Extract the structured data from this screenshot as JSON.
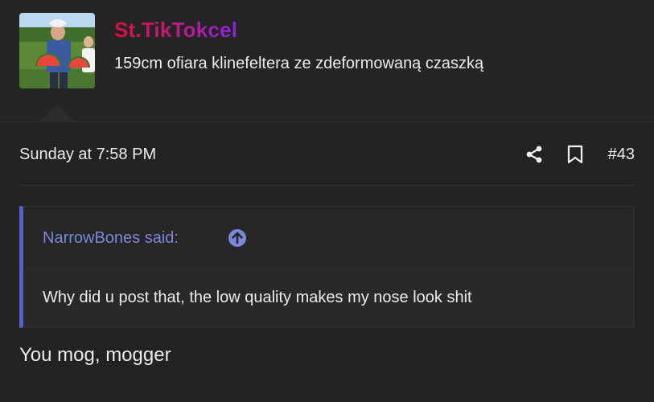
{
  "user": {
    "name": "St.TikTokcel",
    "title": "159cm ofiara klinefeltera ze zdeformowaną czaszką",
    "name_gradient": [
      "#d7103c",
      "#8a23e0"
    ]
  },
  "post": {
    "date": "Sunday at 7:58 PM",
    "number": "#43",
    "actions": [
      "share-icon",
      "bookmark-icon"
    ],
    "quote": {
      "author_label": "NarrowBones said:",
      "text": "Why did u post that, the low quality makes my nose look shit",
      "accent_color": "#5660c8"
    },
    "content": "You mog, mogger"
  }
}
